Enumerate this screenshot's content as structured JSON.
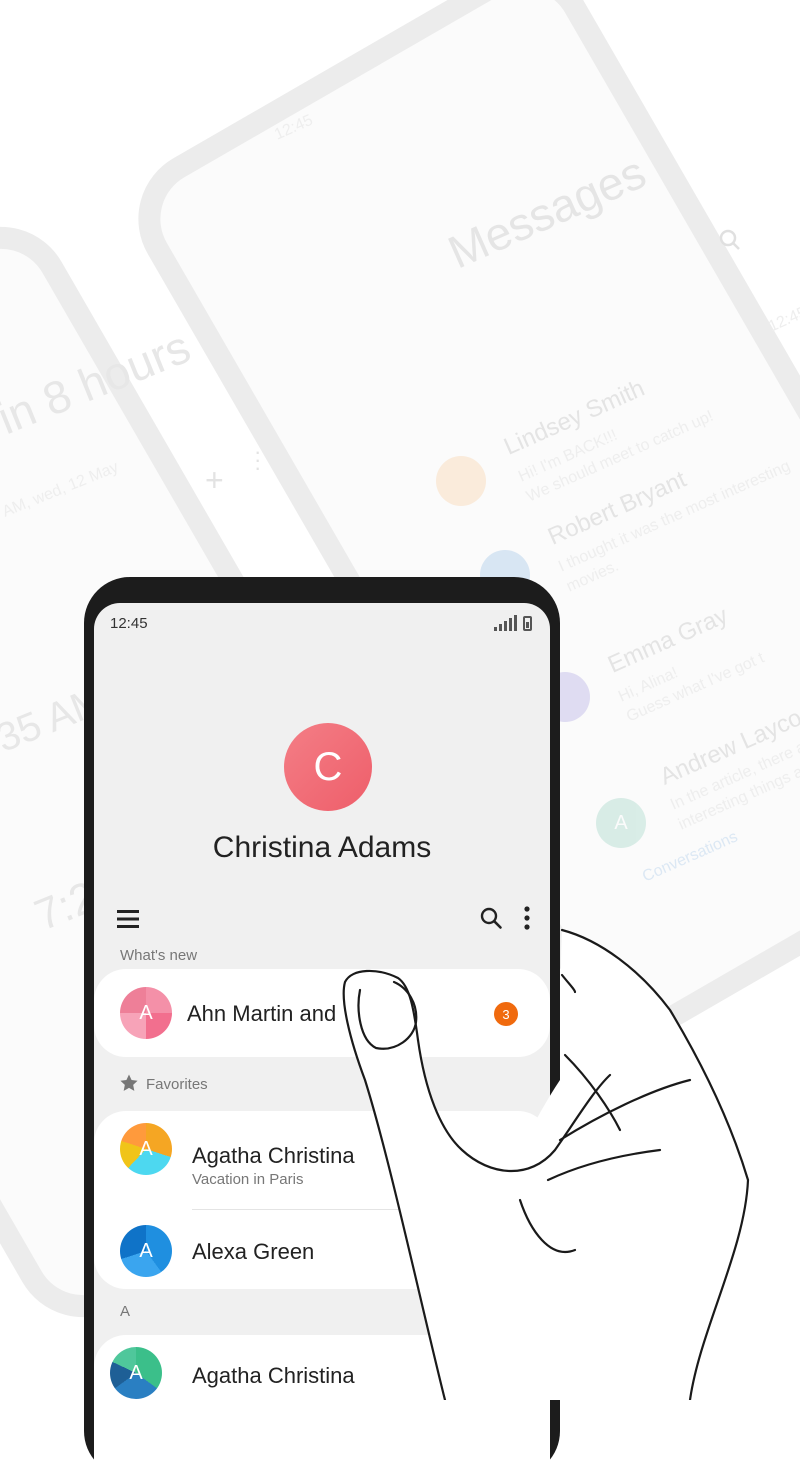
{
  "background": {
    "clock_phone": {
      "headline": "in 8 hours",
      "alarm_date": "AM, wed, 12 May",
      "time_partial": "35 AM",
      "time_partial_2": "7:2"
    },
    "messages_phone": {
      "status_time": "12:45",
      "title": "Messages",
      "timestamp": "12:45",
      "threads": [
        {
          "name": "Lindsey Smith",
          "preview": "Hi! I'm BACK!!!",
          "preview2": "We should meet to catch up!"
        },
        {
          "name": "Robert Bryant",
          "preview": "I thought it was the most interesting",
          "preview2": "movies."
        },
        {
          "name": "Emma Gray",
          "preview": "Hi, Alina!",
          "preview2": "Guess what I've got t"
        },
        {
          "name": "Andrew Laycock",
          "preview": "In the article, there are",
          "preview2": "interesting things abo"
        }
      ],
      "tab_label": "Conversations"
    }
  },
  "phone": {
    "status_time": "12:45",
    "profile": {
      "initial": "C",
      "name": "Christina Adams"
    },
    "whats_new": {
      "label": "What's new",
      "item": {
        "initial": "A",
        "name": "Ahn Martin and",
        "badge": "3"
      }
    },
    "favorites": {
      "label": "Favorites",
      "items": [
        {
          "initial": "A",
          "name": "Agatha Christina",
          "subtitle": "Vacation in Paris"
        },
        {
          "initial": "A",
          "name": "Alexa Green"
        }
      ]
    },
    "index_section": {
      "label": "A",
      "items": [
        {
          "initial": "A",
          "name": "Agatha Christina"
        }
      ]
    }
  },
  "colors": {
    "profile_avatar": "#ee5e6a",
    "badge": "#f06a0e",
    "screen_bg": "#f0f0f0",
    "phone_frame": "#1c1c1c"
  },
  "icons": [
    "signal-icon",
    "battery-icon",
    "menu-icon",
    "search-icon",
    "more-vertical-icon",
    "star-icon"
  ]
}
